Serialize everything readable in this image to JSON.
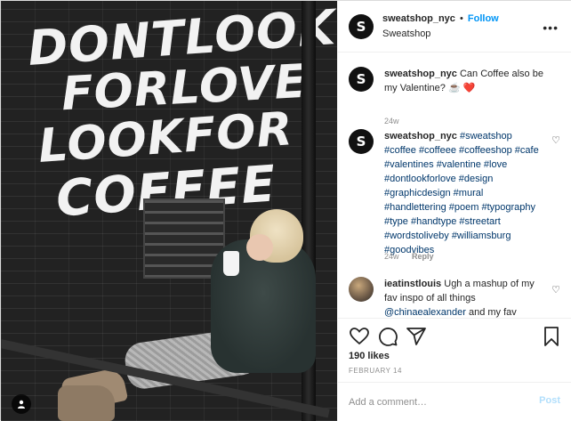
{
  "photo": {
    "mural_lines": [
      "DONTLOOK",
      "FORLOVE",
      "LOOKFOR",
      "COFFEE"
    ],
    "tag_icon": "user-tag-icon"
  },
  "header": {
    "avatar_letter": "S",
    "username": "sweatshop_nyc",
    "separator": "•",
    "follow_label": "Follow",
    "subtitle": "Sweatshop",
    "more_icon": "more-options-icon",
    "more_glyph": "•••"
  },
  "comments": [
    {
      "avatar_letter": "S",
      "username": "sweatshop_nyc",
      "text": "Can Coffee also be my Valentine? ☕️ ",
      "emoji_heart": "❤️",
      "time": "24w"
    },
    {
      "avatar_letter": "S",
      "username": "sweatshop_nyc",
      "text": "#sweatshop #coffee #coffeee #coffeeshop #cafe #valentines #valentine #love #dontlookforlove #design #graphicdesign #mural #handlettering #poem #typography #type #handtype #streetart #wordstoliveby #williamsburg #goodvibes",
      "time": "24w",
      "reply": "Reply"
    },
    {
      "username": "ieatinstlouis",
      "text": "Ugh a mashup of my fav inspo of all things",
      "mention": "@chinaealexander",
      "text_tail": " and my fav"
    }
  ],
  "actions": {
    "like_icon": "heart-icon",
    "comment_icon": "comment-icon",
    "share_icon": "share-icon",
    "save_icon": "bookmark-icon",
    "likes": "190 likes",
    "date": "FEBRUARY 14"
  },
  "add_comment": {
    "placeholder": "Add a comment…",
    "post_label": "Post"
  },
  "colors": {
    "accent": "#0095f6",
    "hashtag": "#00376b",
    "muted": "#8e8e8e",
    "post_disabled": "#b2dffc"
  }
}
